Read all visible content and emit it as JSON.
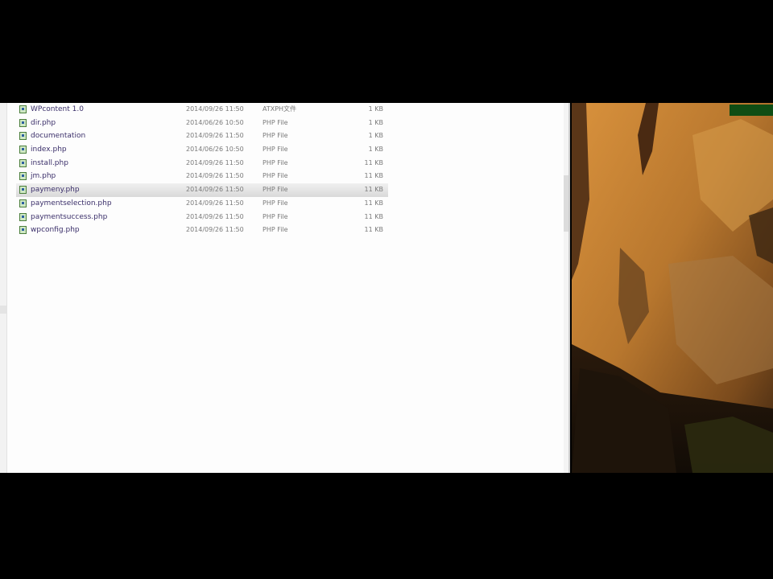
{
  "explorer": {
    "files": [
      {
        "name": "WPcontent 1.0",
        "modified": "2014/09/26 11:50",
        "type": "ATXPH文件",
        "size": "1 KB",
        "selected": false
      },
      {
        "name": "dir.php",
        "modified": "2014/06/26 10:50",
        "type": "PHP File",
        "size": "1 KB",
        "selected": false
      },
      {
        "name": "documentation",
        "modified": "2014/09/26 11:50",
        "type": "PHP File",
        "size": "1 KB",
        "selected": false
      },
      {
        "name": "index.php",
        "modified": "2014/06/26 10:50",
        "type": "PHP File",
        "size": "1 KB",
        "selected": false
      },
      {
        "name": "install.php",
        "modified": "2014/09/26 11:50",
        "type": "PHP File",
        "size": "11 KB",
        "selected": false
      },
      {
        "name": "jm.php",
        "modified": "2014/09/26 11:50",
        "type": "PHP File",
        "size": "11 KB",
        "selected": false
      },
      {
        "name": "paymeny.php",
        "modified": "2014/09/26 11:50",
        "type": "PHP File",
        "size": "11 KB",
        "selected": true
      },
      {
        "name": "paymentselection.php",
        "modified": "2014/09/26 11:50",
        "type": "PHP File",
        "size": "11 KB",
        "selected": false
      },
      {
        "name": "paymentsuccess.php",
        "modified": "2014/09/26 11:50",
        "type": "PHP File",
        "size": "11 KB",
        "selected": false
      },
      {
        "name": "wpconfig.php",
        "modified": "2014/09/26 11:50",
        "type": "PHP File",
        "size": "11 KB",
        "selected": false
      }
    ]
  },
  "icons": {
    "file_icon": "php-file-icon"
  },
  "colors": {
    "desktop_bg": "#000000",
    "explorer_bg": "#fdfdfd",
    "selection_top": "#f0f0f0",
    "selection_bottom": "#d9d9d9",
    "cliff_light": "#c98a3c",
    "cliff_dark": "#3a2410",
    "desktop_icon_green": "#0f4d14"
  }
}
